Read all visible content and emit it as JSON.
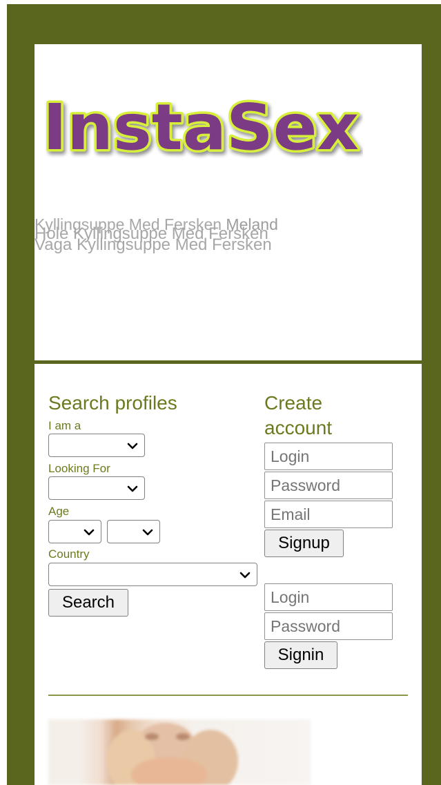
{
  "brand": {
    "logo_text": "InstaSex",
    "colors": {
      "frame": "#5a651e",
      "accent": "#6b7a1f",
      "logo_fill": "#7b3a85",
      "logo_stroke": "#d7ef3a",
      "ghost_text": "#a7a7a7"
    }
  },
  "ghost": {
    "line1": "Kyllingsuppe Med Fersken",
    "line1_suffix": " Meland",
    "line2": "Hole Kyllingsuppe Med Fersken",
    "line3": "Vaga Kyllingsuppe Med Fersken"
  },
  "search": {
    "title": "Search profiles",
    "i_am_label": "I am a",
    "i_am_value": "",
    "looking_for_label": "Looking For",
    "looking_for_value": "",
    "age_label": "Age",
    "age_from_value": "",
    "age_to_value": "",
    "country_label": "Country",
    "country_value": "",
    "search_button": "Search"
  },
  "create_account": {
    "title_line1": "Create",
    "title_line2": "account",
    "login_placeholder": "Login",
    "password_placeholder": "Password",
    "email_placeholder": "Email",
    "signup_button": "Signup"
  },
  "signin": {
    "login_placeholder": "Login",
    "password_placeholder": "Password",
    "signin_button": "Signin"
  },
  "icons": {
    "select_chevron": "chevron-down-icon",
    "profile_photo": "blurred-profile-photo"
  }
}
